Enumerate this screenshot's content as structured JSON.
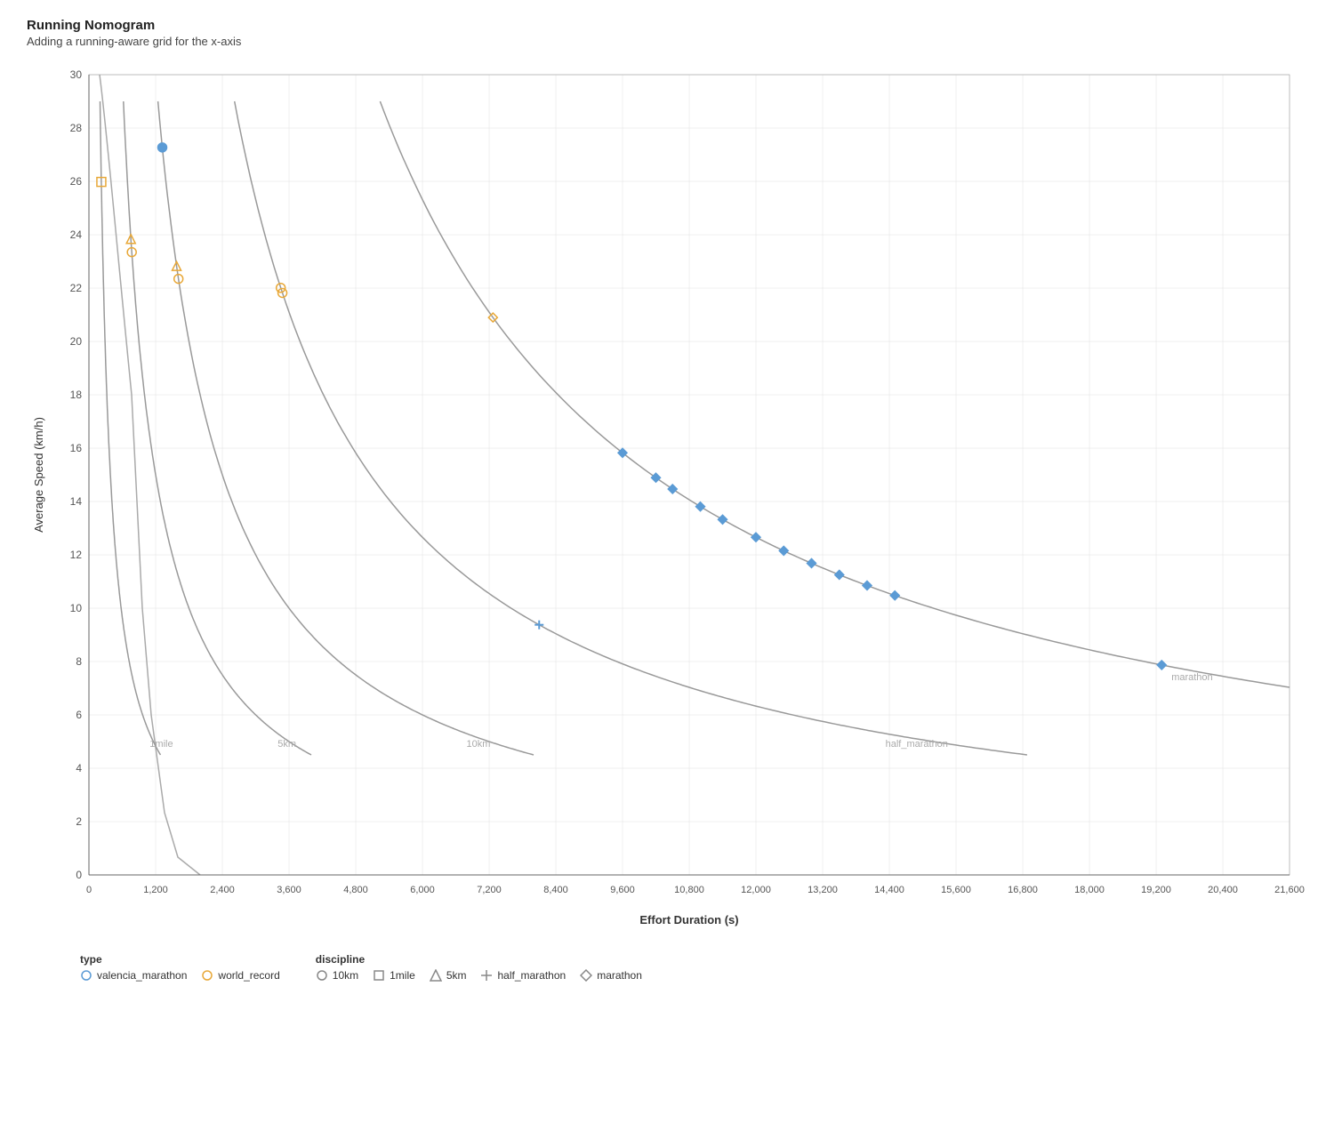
{
  "title": "Running Nomogram",
  "subtitle": "Adding a running-aware grid for the x-axis",
  "chart": {
    "xAxis": {
      "label": "Effort Duration (s)",
      "min": 0,
      "max": 21600,
      "ticks": [
        0,
        1200,
        2400,
        3600,
        4800,
        6000,
        7200,
        8400,
        9600,
        10800,
        12000,
        13200,
        14400,
        15600,
        16800,
        18000,
        19200,
        20400,
        21600
      ],
      "tickLabels": [
        "0",
        "1,200",
        "2,400",
        "3,600",
        "4,800",
        "6,000",
        "7,200",
        "8,400",
        "9,600",
        "10,800",
        "12,000",
        "13,200",
        "14,400",
        "15,600",
        "16,800",
        "18,000",
        "19,200",
        "20,400",
        "21,600"
      ]
    },
    "yAxis": {
      "label": "Average Speed (km/h)",
      "min": 0,
      "max": 30,
      "ticks": [
        0,
        2,
        4,
        6,
        8,
        10,
        12,
        14,
        16,
        18,
        20,
        22,
        24,
        26,
        28,
        30
      ]
    },
    "gridLines": [
      {
        "distance": "1mile",
        "label": "1mile"
      },
      {
        "distance": "5km",
        "label": "5km"
      },
      {
        "distance": "10km",
        "label": "10km"
      },
      {
        "distance": "half_marathon",
        "label": "half_marathon"
      },
      {
        "distance": "marathon",
        "label": "marathon"
      }
    ]
  },
  "legend": {
    "type": {
      "title": "type",
      "items": [
        {
          "label": "valencia_marathon",
          "shape": "circle",
          "color": "#5b9bd5",
          "filled": false
        },
        {
          "label": "world_record",
          "shape": "circle",
          "color": "#e8a838",
          "filled": false
        }
      ]
    },
    "discipline": {
      "title": "discipline",
      "items": [
        {
          "label": "10km",
          "shape": "circle",
          "color": "#888",
          "filled": false
        },
        {
          "label": "1mile",
          "shape": "square",
          "color": "#888",
          "filled": false
        },
        {
          "label": "5km",
          "shape": "triangle",
          "color": "#888",
          "filled": false
        },
        {
          "label": "half_marathon",
          "shape": "cross",
          "color": "#888",
          "filled": false
        },
        {
          "label": "marathon",
          "shape": "diamond",
          "color": "#888",
          "filled": false
        }
      ]
    }
  }
}
